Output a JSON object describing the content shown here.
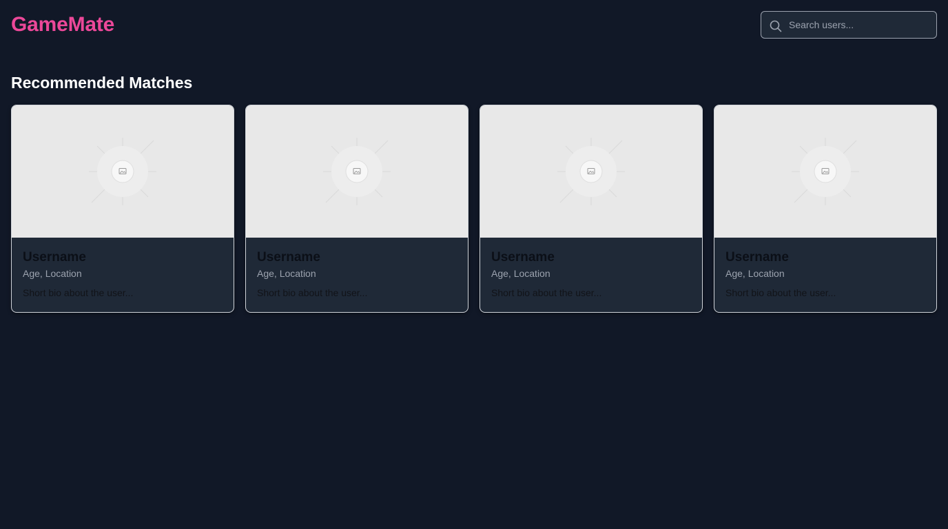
{
  "header": {
    "logo": "GameMate",
    "search": {
      "placeholder": "Search users...",
      "value": ""
    }
  },
  "main": {
    "section_title": "Recommended Matches",
    "cards": [
      {
        "name": "Username",
        "meta": "Age, Location",
        "bio": "Short bio about the user..."
      },
      {
        "name": "Username",
        "meta": "Age, Location",
        "bio": "Short bio about the user..."
      },
      {
        "name": "Username",
        "meta": "Age, Location",
        "bio": "Short bio about the user..."
      },
      {
        "name": "Username",
        "meta": "Age, Location",
        "bio": "Short bio about the user..."
      }
    ]
  },
  "icons": {
    "search": "search-icon",
    "image_placeholder": "image-placeholder-icon"
  },
  "colors": {
    "background": "#111827",
    "brand": "#ec4899",
    "card_body": "#1f2937",
    "card_image": "#e8e8e8",
    "search_bg": "#1f2937",
    "muted_text": "#9ca3af"
  }
}
